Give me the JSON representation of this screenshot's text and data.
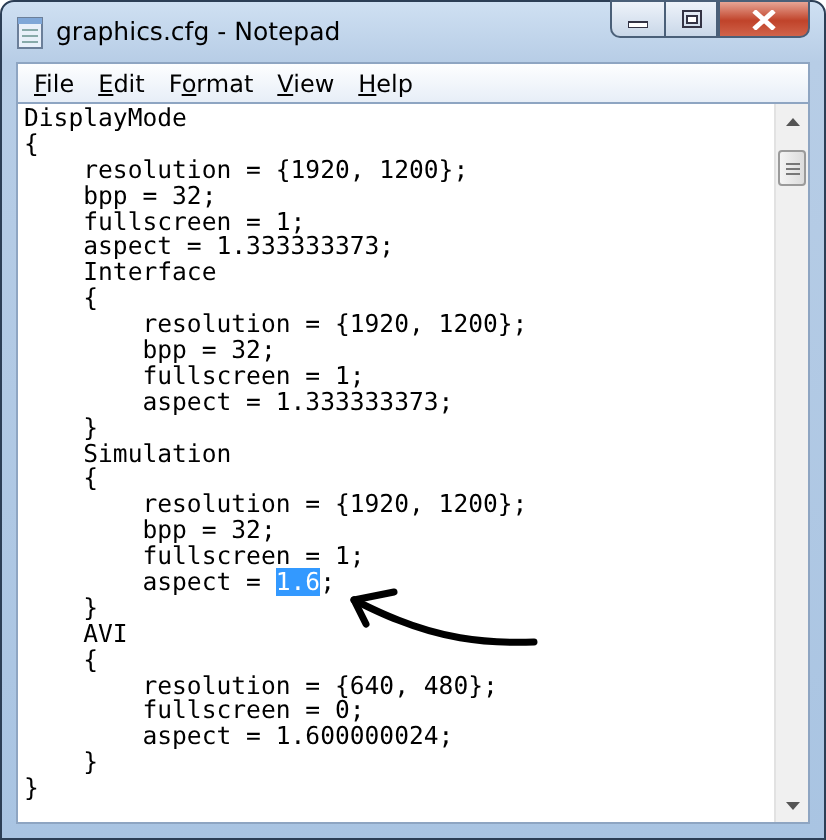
{
  "window": {
    "title": "graphics.cfg - Notepad"
  },
  "menu": [
    {
      "key": "F",
      "after": "ile"
    },
    {
      "key": "E",
      "after": "dit"
    },
    {
      "before": "F",
      "key": "o",
      "after": "rmat"
    },
    {
      "key": "V",
      "after": "iew"
    },
    {
      "key": "H",
      "after": "elp"
    }
  ],
  "lines": [
    {
      "segments": [
        {
          "text": "DisplayMode",
          "selected": false
        }
      ]
    },
    {
      "segments": [
        {
          "text": "{",
          "selected": false
        }
      ]
    },
    {
      "segments": [
        {
          "text": "    resolution = {1920, 1200};",
          "selected": false
        }
      ]
    },
    {
      "segments": [
        {
          "text": "    bpp = 32;",
          "selected": false
        }
      ]
    },
    {
      "segments": [
        {
          "text": "    fullscreen = 1;",
          "selected": false
        }
      ]
    },
    {
      "segments": [
        {
          "text": "    aspect = 1.333333373;",
          "selected": false
        }
      ]
    },
    {
      "segments": [
        {
          "text": "    Interface",
          "selected": false
        }
      ]
    },
    {
      "segments": [
        {
          "text": "    {",
          "selected": false
        }
      ]
    },
    {
      "segments": [
        {
          "text": "        resolution = {1920, 1200};",
          "selected": false
        }
      ]
    },
    {
      "segments": [
        {
          "text": "        bpp = 32;",
          "selected": false
        }
      ]
    },
    {
      "segments": [
        {
          "text": "        fullscreen = 1;",
          "selected": false
        }
      ]
    },
    {
      "segments": [
        {
          "text": "        aspect = 1.333333373;",
          "selected": false
        }
      ]
    },
    {
      "segments": [
        {
          "text": "    }",
          "selected": false
        }
      ]
    },
    {
      "segments": [
        {
          "text": "    Simulation",
          "selected": false
        }
      ]
    },
    {
      "segments": [
        {
          "text": "    {",
          "selected": false
        }
      ]
    },
    {
      "segments": [
        {
          "text": "        resolution = {1920, 1200};",
          "selected": false
        }
      ]
    },
    {
      "segments": [
        {
          "text": "        bpp = 32;",
          "selected": false
        }
      ]
    },
    {
      "segments": [
        {
          "text": "        fullscreen = 1;",
          "selected": false
        }
      ]
    },
    {
      "segments": [
        {
          "text": "        aspect = ",
          "selected": false
        },
        {
          "text": "1.6",
          "selected": true
        },
        {
          "text": ";",
          "selected": false
        }
      ]
    },
    {
      "segments": [
        {
          "text": "    }",
          "selected": false
        }
      ]
    },
    {
      "segments": [
        {
          "text": "    AVI",
          "selected": false
        }
      ]
    },
    {
      "segments": [
        {
          "text": "    {",
          "selected": false
        }
      ]
    },
    {
      "segments": [
        {
          "text": "        resolution = {640, 480};",
          "selected": false
        }
      ]
    },
    {
      "segments": [
        {
          "text": "        fullscreen = 0;",
          "selected": false
        }
      ]
    },
    {
      "segments": [
        {
          "text": "        aspect = 1.600000024;",
          "selected": false
        }
      ]
    },
    {
      "segments": [
        {
          "text": "    }",
          "selected": false
        }
      ]
    },
    {
      "segments": [
        {
          "text": "}",
          "selected": false
        }
      ]
    }
  ]
}
